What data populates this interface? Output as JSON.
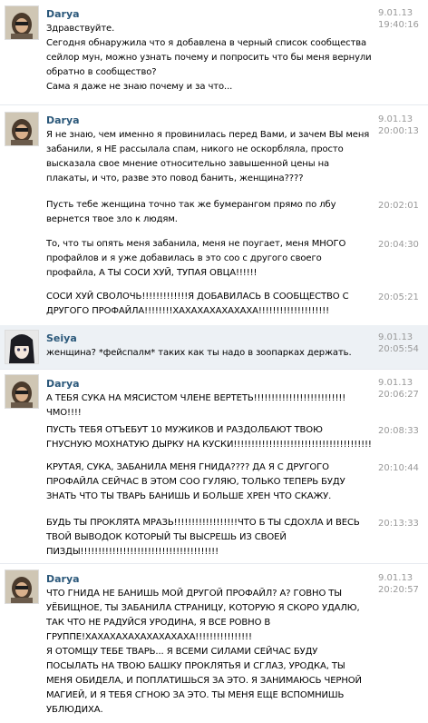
{
  "messages": [
    {
      "author": "Darya",
      "avatar": "darya-avatar",
      "date": "9.01.13",
      "time": "19:40:16",
      "text": "Здравствуйте.\nСегодня обнаружила что я добавлена в черный список сообщества\nсейлор мун, можно узнать почему и попросить что бы меня вернули\nобратно в сообщество?\nСама я даже не знаю почему и за что..."
    },
    {
      "author": "Darya",
      "avatar": "darya-avatar",
      "date": "9.01.13",
      "time": "20:00:13",
      "text": "Я не знаю, чем именно я провинилась перед Вами, и зачем ВЫ меня\nзабанили, я НЕ рассылала спам, никого не оскорбляла, просто\nвысказала свое мнение относительно завышенной цены на\nплакаты, и что, разве это повод банить, женщина????"
    },
    {
      "time": "20:02:01",
      "text": "Пусть тебе женщина точно так же бумерангом прямо по лбу\nвернется твое зло к людям."
    },
    {
      "time": "20:04:30",
      "text": "То, что ты опять меня забанила, меня не поугает, меня МНОГО\nпрофайлов и я уже добавилась в это соо с другого своего\nпрофайла, А ТЫ СОСИ ХУЙ, ТУПАЯ ОВЦА!!!!!!"
    },
    {
      "time": "20:05:21",
      "text": "СОСИ ХУЙ СВОЛОЧЬ!!!!!!!!!!!!!Я ДОБАВИЛАСЬ В СООБЩЕСТВО С\nДРУГОГО ПРОФАЙЛА!!!!!!!!ХАХАХАХАХАХАХА!!!!!!!!!!!!!!!!!!!!"
    },
    {
      "author": "Seiya",
      "avatar": "seiya-avatar",
      "date": "9.01.13",
      "time": "20:05:54",
      "text": "женщина? *фейспалм* таких как ты надо в зоопарках держать."
    },
    {
      "author": "Darya",
      "avatar": "darya-avatar",
      "date": "9.01.13",
      "time": "20:06:27",
      "text": "А ТЕБЯ СУКА НА МЯСИСТОМ ЧЛЕНЕ ВЕРТЕТЬ!!!!!!!!!!!!!!!!!!!!!!!!!!ЧМО!!!!"
    },
    {
      "time": "20:08:33",
      "text": "ПУСТЬ ТЕБЯ ОТЪЕБУТ 10 МУЖИКОВ И РАЗДОЛБАЮТ ТВОЮ\nГНУСНУЮ МОХНАТУЮ ДЫРКУ НА КУСКИ!!!!!!!!!!!!!!!!!!!!!!!!!!!!!!!!!!!!!!!"
    },
    {
      "time": "20:10:44",
      "text": "КРУТАЯ, СУКА, ЗАБАНИЛА МЕНЯ ГНИДА???? ДА Я С ДРУГОГО\nПРОФАЙЛА СЕЙЧАС В ЭТОМ СОО ГУЛЯЮ, ТОЛЬКО ТЕПЕРЬ БУДУ\nЗНАТЬ ЧТО ТЫ ТВАРЬ БАНИШЬ И БОЛЬШЕ ХРЕН ЧТО СКАЖУ."
    },
    {
      "time": "20:13:33",
      "text": "БУДЬ ТЫ ПРОКЛЯТА МРАЗЬ!!!!!!!!!!!!!!!!!!ЧТО Б ТЫ СДОХЛА И ВЕСЬ\nТВОЙ ВЫВОДОК КОТОРЫЙ ТЫ ВЫСРЕШЬ ИЗ СВОЕЙ\nПИЗДЫ!!!!!!!!!!!!!!!!!!!!!!!!!!!!!!!!!!!!!!!"
    },
    {
      "author": "Darya",
      "avatar": "darya-avatar",
      "date": "9.01.13",
      "time": "20:20:57",
      "text": "ЧТО ГНИДА НЕ БАНИШЬ МОЙ ДРУГОЙ ПРОФАЙЛ? А? ГОВНО ТЫ\nУЁБИЩНОЕ, ТЫ ЗАБАНИЛА СТРАНИЦУ, КОТОРУЮ Я СКОРО УДАЛЮ,\nТАК ЧТО НЕ РАДУЙСЯ УРОДИНА, Я ВСЕ РОВНО В\nГРУППЕ!ХАХАХАХАХАХАХАХАХА!!!!!!!!!!!!!!!!\nЯ ОТОМЩУ ТЕБЕ ТВАРЬ... Я ВСЕМИ СИЛАМИ СЕЙЧАС БУДУ\nПОСЫЛАТЬ НА ТВОЮ БАШКУ ПРОКЛЯТЬЯ И СГЛАЗ, УРОДКА, ТЫ\nМЕНЯ ОБИДЕЛА, И ПОПЛАТИШЬСЯ ЗА ЭТО. Я ЗАНИМАЮСЬ ЧЕРНОЙ\nМАГИЕЙ, И Я ТЕБЯ СГНОЮ ЗА ЭТО. ТЫ МЕНЯ ЕЩЕ ВСПОМНИШЬ\nУБЛЮДИХА."
    }
  ]
}
